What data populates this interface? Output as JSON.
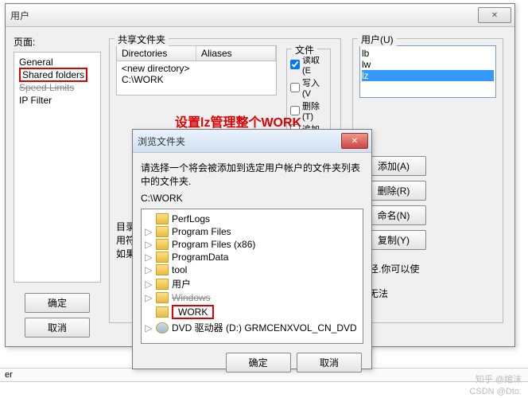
{
  "mainWindow": {
    "title": "用户",
    "pageLabel": "页面:",
    "tree": {
      "items": [
        "General",
        "Shared folders",
        "Speed Limits",
        "IP Filter"
      ],
      "highlightIndex": 1
    },
    "sharedGroup": "共享文件夹",
    "dirCols": {
      "c1": "Directories",
      "c2": "Aliases"
    },
    "dirRows": {
      "r1": "<new directory>",
      "r2": "C:\\WORK"
    },
    "fileGroup": "文件",
    "perms": {
      "read": "读取(E",
      "write": "写入(V",
      "delete": "删除(T)",
      "append": "追加"
    },
    "dirGroup": "目录",
    "usersGroup": "用户(U)",
    "users": {
      "u1": "lb",
      "u2": "lw",
      "u3": "lz"
    },
    "buttons": {
      "add": "添加(A)",
      "remove": "删除(R)",
      "rename": "命名(N)",
      "copy": "复制(Y)"
    },
    "note1": "目录",
    "note2": "用符",
    "note3": "如果(",
    "note4": "路径.你可以使",
    "note5": "踏无法",
    "ok": "确定",
    "cancel": "取消"
  },
  "annotation": "设置lz管理整个WORK",
  "browseDialog": {
    "title": "浏览文件夹",
    "instruction": "请选择一个将会被添加到选定用户帐户的文件夹列表中的文件夹.",
    "path": "C:\\WORK",
    "items": [
      {
        "label": "PerfLogs",
        "exp": ""
      },
      {
        "label": "Program Files",
        "exp": "▷"
      },
      {
        "label": "Program Files (x86)",
        "exp": "▷"
      },
      {
        "label": "ProgramData",
        "exp": "▷"
      },
      {
        "label": "tool",
        "exp": "▷"
      },
      {
        "label": "用户",
        "exp": "▷"
      },
      {
        "label": "Windows",
        "exp": "▷",
        "strike": true
      },
      {
        "label": "WORK",
        "exp": "",
        "sel": true
      },
      {
        "label": "DVD 驱动器 (D:) GRMCENXVOL_CN_DVD",
        "exp": "▷",
        "disc": true
      }
    ],
    "ok": "确定",
    "cancel": "取消"
  },
  "statusbar": "er",
  "watermarks": {
    "zhihu": "知乎 @婠沫",
    "csdn": "CSDN @Dto."
  }
}
